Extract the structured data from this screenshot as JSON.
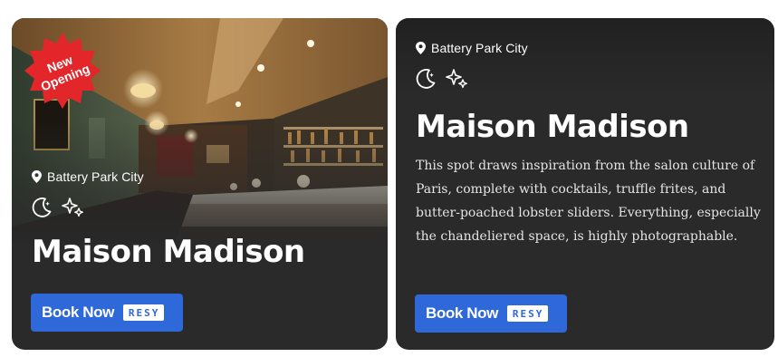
{
  "cards": [
    {
      "badge": {
        "line1": "New",
        "line2": "Opening",
        "color": "#e3262a"
      },
      "location": "Battery Park City",
      "icons": [
        "moon-icon",
        "sparkle-icon"
      ],
      "title": "Maison Madison",
      "book": {
        "label": "Book Now",
        "partner": "RESY"
      }
    },
    {
      "location": "Battery Park City",
      "icons": [
        "moon-icon",
        "sparkle-icon"
      ],
      "title": "Maison Madison",
      "description": "This spot draws inspiration from the salon culture of Paris, complete with cocktails, truffle frites, and butter-poached lobster sliders. Everything, especially the chandeliered space, is highly photographable.",
      "book": {
        "label": "Book Now",
        "partner": "RESY"
      }
    }
  ],
  "colors": {
    "card_bg": "#2a2a2a",
    "button_bg": "#2f68d8",
    "badge": "#e3262a"
  }
}
